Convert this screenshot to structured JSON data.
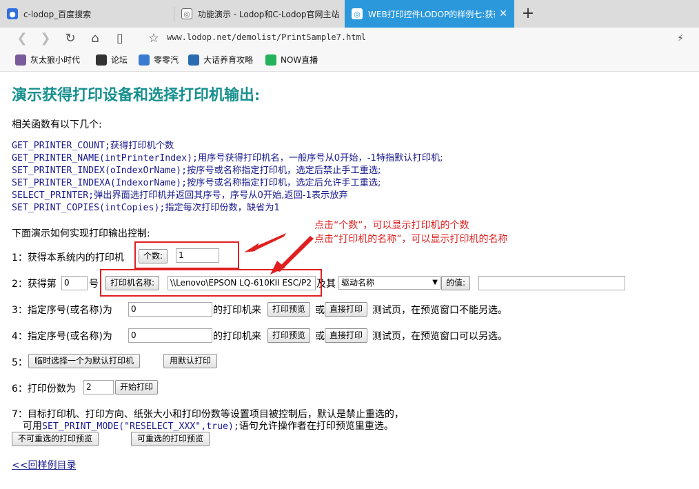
{
  "tabs": [
    {
      "title": "c-lodop_百度搜索",
      "icon_color": "#3070e0"
    },
    {
      "title": "功能演示 - Lodop和C-Lodop官网主站",
      "icon_color": "#666666"
    },
    {
      "title": "WEB打印控件LODOP的样例七:获得打印",
      "icon_color": "#2b98dc"
    }
  ],
  "new_tab": "+",
  "address": {
    "url": "www.lodop.net/demolist/PrintSample7.html"
  },
  "bookmarks": [
    {
      "label": "灰太狼小时代",
      "color": "#7a5a9a"
    },
    {
      "label": "论坛",
      "color": "#333333"
    },
    {
      "label": "零零汽",
      "color": "#3a7ad0"
    },
    {
      "label": "大话养育攻略",
      "color": "#2a6ab0"
    },
    {
      "label": "NOW直播",
      "color": "#22b35a"
    }
  ],
  "page": {
    "title": "演示获得打印设备和选择打印机输出:",
    "intro": "相关函数有以下几个:",
    "functions": [
      {
        "code": "GET_PRINTER_COUNT;",
        "desc": "获得打印机个数"
      },
      {
        "code": "GET_PRINTER_NAME(intPrinterIndex);",
        "desc": "用序号获得打印机名，一般序号从0开始，-1特指默认打印机;"
      },
      {
        "code": "SET_PRINTER_INDEX(oIndexOrName);",
        "desc": "按序号或名称指定打印机，选定后禁止手工重选;"
      },
      {
        "code": "SET_PRINTER_INDEXA(IndexorName);",
        "desc": "按序号或名称指定打印机，选定后允许手工重选;"
      },
      {
        "code": "SELECT_PRINTER;",
        "desc": "弹出界面选打印机并返回其序号，序号从0开始,返回-1表示放弃"
      },
      {
        "code": "SET_PRINT_COPIES(intCopies);",
        "desc": "指定每次打印份数，缺省为1"
      }
    ],
    "demo_intro": "下面演示如何实现打印输出控制:",
    "row1": {
      "label": "1：获得本系统内的打印机",
      "button": "个数:",
      "value": "1"
    },
    "row2": {
      "prefix": "2：获得第",
      "index": "0",
      "suffix": "号",
      "button": "打印机名称:",
      "name_value": "\\\\Lenovo\\EPSON LQ-610KII ESC/P2",
      "and": "及其",
      "driver_select": "驱动名称",
      "value_button": "的值:",
      "value": ""
    },
    "row3": {
      "label": "3：指定序号(或名称)为",
      "value": "0",
      "mid": "的打印机来",
      "preview": "打印预览",
      "or": "或",
      "direct": "直接打印",
      "tail": "测试页，在预览窗口不能另选。"
    },
    "row4": {
      "label": "4：指定序号(或名称)为",
      "value": "0",
      "mid": "的打印机来",
      "preview": "打印预览",
      "or": "或",
      "direct": "直接打印",
      "tail": "测试页，在预览窗口可以另选。"
    },
    "row5": {
      "label": "5：",
      "select_default": "临时选择一个为默认打印机",
      "print_default": "用默认打印"
    },
    "row6": {
      "label": "6：打印份数为",
      "value": "2",
      "button": "开始打印"
    },
    "row7": {
      "line1": "7：目标打印机、打印方向、纸张大小和打印份数等设置项目被控制后，默认是禁止重选的，",
      "line2_prefix": "可用",
      "line2_code": "SET_PRINT_MODE(\"RESELECT_XXX\",true);",
      "line2_suffix": "语句允许操作者在打印预览里重选。",
      "btn_no_reselect": "不可重选的打印预览",
      "btn_reselect": "可重选的打印预览"
    },
    "back_link": "<<回样例目录"
  },
  "annotations": {
    "line1": "点击“个数”，可以显示打印机的个数",
    "line2": "点击“打印机的名称”，可以显示打印机的名称",
    "color": "#e02020"
  }
}
